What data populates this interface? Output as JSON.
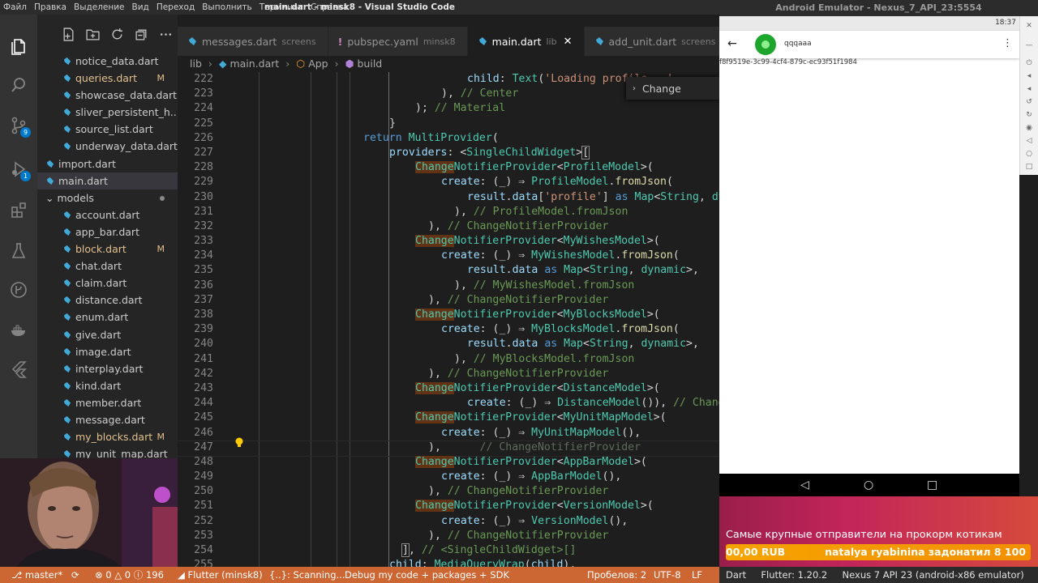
{
  "window": {
    "title": "main.dart - minsk8 - Visual Studio Code",
    "menu": [
      "Файл",
      "Правка",
      "Выделение",
      "Вид",
      "Переход",
      "Выполнить",
      "Терминал",
      "Справка"
    ]
  },
  "activity": {
    "scm_badge": "9",
    "debug_badge": "1"
  },
  "explorer": {
    "files": [
      {
        "name": "notice_data.dart",
        "indent": 2,
        "kind": "dart"
      },
      {
        "name": "queries.dart",
        "indent": 2,
        "kind": "dart",
        "git": "M"
      },
      {
        "name": "showcase_data.dart",
        "indent": 2,
        "kind": "dart"
      },
      {
        "name": "sliver_persistent_h...",
        "indent": 2,
        "kind": "dart"
      },
      {
        "name": "source_list.dart",
        "indent": 2,
        "kind": "dart"
      },
      {
        "name": "underway_data.dart",
        "indent": 2,
        "kind": "dart"
      },
      {
        "name": "import.dart",
        "indent": 1,
        "kind": "dart"
      },
      {
        "name": "main.dart",
        "indent": 1,
        "kind": "dart",
        "active": true
      },
      {
        "name": "models",
        "indent": 1,
        "kind": "folder",
        "dot": true
      },
      {
        "name": "account.dart",
        "indent": 2,
        "kind": "dart"
      },
      {
        "name": "app_bar.dart",
        "indent": 2,
        "kind": "dart"
      },
      {
        "name": "block.dart",
        "indent": 2,
        "kind": "dart",
        "git": "M"
      },
      {
        "name": "chat.dart",
        "indent": 2,
        "kind": "dart"
      },
      {
        "name": "claim.dart",
        "indent": 2,
        "kind": "dart"
      },
      {
        "name": "distance.dart",
        "indent": 2,
        "kind": "dart"
      },
      {
        "name": "enum.dart",
        "indent": 2,
        "kind": "dart"
      },
      {
        "name": "give.dart",
        "indent": 2,
        "kind": "dart"
      },
      {
        "name": "image.dart",
        "indent": 2,
        "kind": "dart"
      },
      {
        "name": "interplay.dart",
        "indent": 2,
        "kind": "dart"
      },
      {
        "name": "kind.dart",
        "indent": 2,
        "kind": "dart"
      },
      {
        "name": "member.dart",
        "indent": 2,
        "kind": "dart"
      },
      {
        "name": "message.dart",
        "indent": 2,
        "kind": "dart"
      },
      {
        "name": "my_blocks.dart",
        "indent": 2,
        "kind": "dart",
        "git": "M"
      },
      {
        "name": "my_unit_map.dart",
        "indent": 2,
        "kind": "dart"
      }
    ]
  },
  "tabs": [
    {
      "label": "messages.dart",
      "desc": "screens",
      "active": false,
      "modified": false
    },
    {
      "label": "pubspec.yaml",
      "desc": "minsk8",
      "active": false,
      "modified": true
    },
    {
      "label": "main.dart",
      "desc": "lib",
      "active": true,
      "modified": false
    },
    {
      "label": "add_unit.dart",
      "desc": "screens",
      "active": false,
      "modified": false
    }
  ],
  "breadcrumb": [
    "lib",
    "main.dart",
    "App",
    "build"
  ],
  "find_widget": {
    "label": "Change"
  },
  "editor": {
    "lines": [
      {
        "n": "222",
        "i": 2,
        "h": "<span class=\"v\">child</span>: <span class=\"c\">Text</span>(<span class=\"s\">'Loading profile...'</span>"
      },
      {
        "n": "223",
        "i": 1,
        "h": "), <span class=\"cm\">// Center</span>"
      },
      {
        "n": "224",
        "i": 0,
        "h": "); <span class=\"cm\">// Material</span>"
      },
      {
        "n": "225",
        "i": -1,
        "h": "}"
      },
      {
        "n": "226",
        "i": -2,
        "h": "<span class=\"k\">return</span> <span class=\"c\">MultiProvider</span>("
      },
      {
        "n": "227",
        "i": -1,
        "h": "<span class=\"v\">providers</span>: &lt;<span class=\"c\">SingleChildWidget</span>&gt;<span class=\"br\">[</span>"
      },
      {
        "n": "228",
        "i": 0,
        "h": "<span class=\"hl\">Change</span><span class=\"c\">NotifierProvider</span>&lt;<span class=\"c\">ProfileModel</span>&gt;("
      },
      {
        "n": "229",
        "i": 1,
        "h": "<span class=\"v\">create</span>: (_) ⇒ <span class=\"c\">ProfileModel</span>.<span class=\"f\">fromJson</span>("
      },
      {
        "n": "230",
        "i": 2,
        "h": "<span class=\"v\">result</span>.<span class=\"v\">data</span>[<span class=\"s\">'profile'</span>] <span class=\"k\">as</span> <span class=\"c\">Map</span>&lt;<span class=\"c\">String</span>, <span class=\"c\">dynamic</span>&gt;,"
      },
      {
        "n": "231",
        "i": 1.5,
        "h": "), <span class=\"cm\">// ProfileModel.fromJson</span>"
      },
      {
        "n": "232",
        "i": 0.5,
        "h": "), <span class=\"cm\">// ChangeNotifierProvider</span>"
      },
      {
        "n": "233",
        "i": 0,
        "h": "<span class=\"hl\">Change</span><span class=\"c\">NotifierProvider</span>&lt;<span class=\"c\">MyWishesModel</span>&gt;("
      },
      {
        "n": "234",
        "i": 1,
        "h": "<span class=\"v\">create</span>: (_) ⇒ <span class=\"c\">MyWishesModel</span>.<span class=\"f\">fromJson</span>("
      },
      {
        "n": "235",
        "i": 2,
        "h": "<span class=\"v\">result</span>.<span class=\"v\">data</span> <span class=\"k\">as</span> <span class=\"c\">Map</span>&lt;<span class=\"c\">String</span>, <span class=\"c\">dynamic</span>&gt;,"
      },
      {
        "n": "236",
        "i": 1.5,
        "h": "), <span class=\"cm\">// MyWishesModel.fromJson</span>"
      },
      {
        "n": "237",
        "i": 0.5,
        "h": "), <span class=\"cm\">// ChangeNotifierProvider</span>"
      },
      {
        "n": "238",
        "i": 0,
        "h": "<span class=\"hl\">Change</span><span class=\"c\">NotifierProvider</span>&lt;<span class=\"c\">MyBlocksModel</span>&gt;("
      },
      {
        "n": "239",
        "i": 1,
        "h": "<span class=\"v\">create</span>: (_) ⇒ <span class=\"c\">MyBlocksModel</span>.<span class=\"f\">fromJson</span>("
      },
      {
        "n": "240",
        "i": 2,
        "h": "<span class=\"v\">result</span>.<span class=\"v\">data</span> <span class=\"k\">as</span> <span class=\"c\">Map</span>&lt;<span class=\"c\">String</span>, <span class=\"c\">dynamic</span>&gt;,"
      },
      {
        "n": "241",
        "i": 1.5,
        "h": "), <span class=\"cm\">// MyBlocksModel.fromJson</span>"
      },
      {
        "n": "242",
        "i": 0.5,
        "h": "), <span class=\"cm\">// ChangeNotifierProvider</span>"
      },
      {
        "n": "243",
        "i": 0,
        "h": "<span class=\"hl\">Change</span><span class=\"c\">NotifierProvider</span>&lt;<span class=\"c\">DistanceModel</span>&gt;("
      },
      {
        "n": "244",
        "i": 2,
        "h": "<span class=\"v\">create</span>: (_) ⇒ <span class=\"c\">DistanceModel</span>()), <span class=\"cm\">// ChangeNotifierProvider</span>"
      },
      {
        "n": "245",
        "i": 0,
        "h": "<span class=\"hl\">Change</span><span class=\"c\">NotifierProvider</span>&lt;<span class=\"c\">MyUnitMapModel</span>&gt;("
      },
      {
        "n": "246",
        "i": 1,
        "h": "<span class=\"v\">create</span>: (_) ⇒ <span class=\"c\">MyUnitMapModel</span>(),"
      },
      {
        "n": "247",
        "i": 0.5,
        "h": "),      <span class=\"cmg\">// ChangeNotifierProvider</span>",
        "current": true
      },
      {
        "n": "248",
        "i": 0,
        "h": "<span class=\"hl\">Change</span><span class=\"c\">NotifierProvider</span>&lt;<span class=\"c\">AppBarModel</span>&gt;("
      },
      {
        "n": "249",
        "i": 1,
        "h": "<span class=\"v\">create</span>: (_) ⇒ <span class=\"c\">AppBarModel</span>(),"
      },
      {
        "n": "250",
        "i": 0.5,
        "h": "), <span class=\"cm\">// ChangeNotifierProvider</span>"
      },
      {
        "n": "251",
        "i": 0,
        "h": "<span class=\"hl\">Change</span><span class=\"c\">NotifierProvider</span>&lt;<span class=\"c\">VersionModel</span>&gt;("
      },
      {
        "n": "252",
        "i": 1,
        "h": "<span class=\"v\">create</span>: (_) ⇒ <span class=\"c\">VersionModel</span>(),"
      },
      {
        "n": "253",
        "i": 0.5,
        "h": "), <span class=\"cm\">// ChangeNotifierProvider</span>"
      },
      {
        "n": "254",
        "i": -0.5,
        "h": "<span class=\"br\">]</span>, <span class=\"cm\">// &lt;SingleChildWidget&gt;[]</span>"
      },
      {
        "n": "255",
        "i": -1,
        "h": "<span class=\"v\">child</span>: <span class=\"c\">MediaQueryWrap</span>(<span class=\"v\">child</span>),"
      }
    ]
  },
  "statusbar": {
    "branch": "master*",
    "errors": "0",
    "warnings": "0",
    "infos": "196",
    "flutter": "Flutter (minsk8)",
    "scanning": "{..}: Scanning...",
    "debug": "Debug my code + packages + SDK",
    "spaces": "Пробелов: 2",
    "encoding": "UTF-8",
    "eol": "LF",
    "language": "Dart",
    "flutter_version": "Flutter: 1.20.2",
    "device": "Nexus 7 API 23 (android-x86 emulator)"
  },
  "emulator": {
    "title": "Android Emulator - Nexus_7_API_23:5554",
    "time": "18:37",
    "username": "qqqaaa",
    "id_text": "f8f9519e-3c99-4cf4-879c-ec93f51f1984"
  },
  "donation": {
    "headline": "Самые крупные отправители на прокорм котикам",
    "amount": "00,00 RUB",
    "message": "natalya ryabinina задонатил 8 100"
  },
  "colors": {
    "statusbar": "#cc6633",
    "accent": "#007acc",
    "highlight": "#613214"
  }
}
